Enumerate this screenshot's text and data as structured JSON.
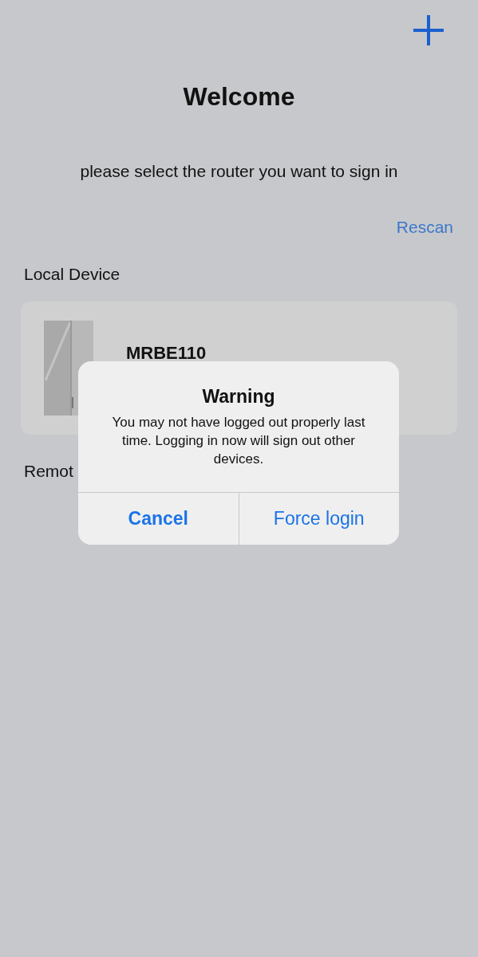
{
  "title": "Welcome",
  "subtitle": "please select the router you want to sign in",
  "rescan": "Rescan",
  "local_section": {
    "label": "Local Device",
    "devices": [
      {
        "name": "MRBE110",
        "kind": "picture"
      }
    ]
  },
  "remote_section": {
    "label": "Remot"
  },
  "dialog": {
    "title": "Warning",
    "message": "You may not have logged out properly last time. Logging in now will sign out other devices.",
    "buttons": [
      {
        "label": "Cancel",
        "preferred": true
      },
      {
        "label": "Force login",
        "preferred": false
      }
    ]
  }
}
